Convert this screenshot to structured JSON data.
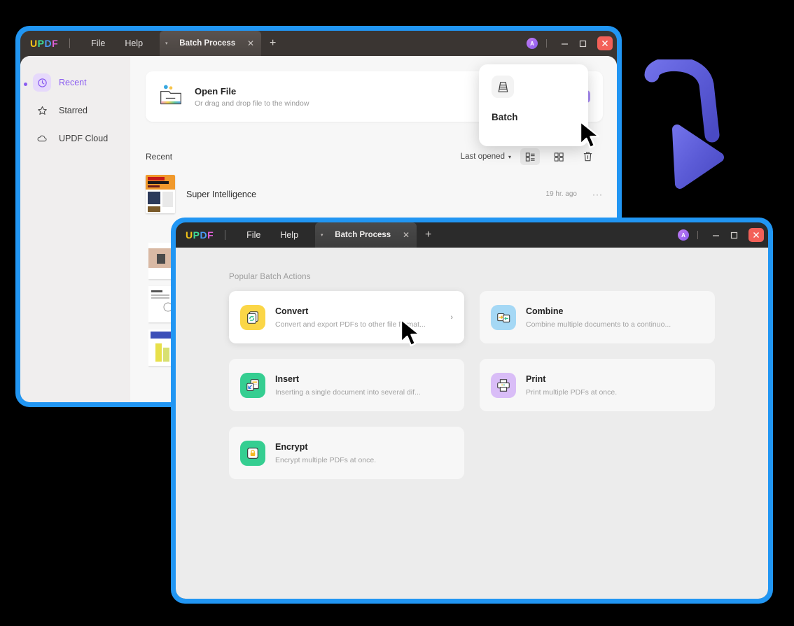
{
  "back_window": {
    "titlebar": {
      "logo": "UPDF",
      "menus": [
        "File",
        "Help"
      ],
      "tab": {
        "label": "Batch Process",
        "close": "✕",
        "caret": "▾"
      },
      "new_tab": "+",
      "avatar": "A",
      "minimize": "—",
      "maximize": "☐",
      "close": "✕"
    },
    "sidebar": {
      "items": [
        {
          "label": "Recent",
          "icon": "clock-icon",
          "active": true
        },
        {
          "label": "Starred",
          "icon": "star-icon",
          "active": false
        },
        {
          "label": "UPDF Cloud",
          "icon": "cloud-icon",
          "active": false
        }
      ]
    },
    "open_file": {
      "title": "Open File",
      "subtitle": "Or drag and drop file to the window",
      "go": "›"
    },
    "recent": {
      "heading": "Recent",
      "sort_label": "Last opened",
      "sort_caret": "▾",
      "view_list_icon": "list-view-icon",
      "view_grid_icon": "grid-view-icon",
      "delete_icon": "trash-icon",
      "items": [
        {
          "name": "Super Intelligence",
          "time": "19 hr. ago",
          "more": "···"
        }
      ]
    },
    "batch_popup": {
      "label": "Batch",
      "icon": "batch-stack-icon"
    }
  },
  "front_window": {
    "titlebar": {
      "logo": "UPDF",
      "menus": [
        "File",
        "Help"
      ],
      "tab": {
        "label": "Batch Process",
        "close": "✕",
        "caret": "▾"
      },
      "new_tab": "+",
      "avatar": "A",
      "minimize": "—",
      "maximize": "☐",
      "close": "✕"
    },
    "section_title": "Popular Batch Actions",
    "cards": [
      {
        "title": "Convert",
        "subtitle": "Convert and export PDFs to other file format...",
        "icon": "convert-icon",
        "icon_bg": "#fbd647",
        "selected": true,
        "arrow": "›"
      },
      {
        "title": "Combine",
        "subtitle": "Combine multiple documents to a continuo...",
        "icon": "combine-icon",
        "icon_bg": "#a5d8f5",
        "selected": false,
        "arrow": ""
      },
      {
        "title": "Insert",
        "subtitle": "Inserting a single document into several dif...",
        "icon": "insert-icon",
        "icon_bg": "#35ce91",
        "selected": false,
        "arrow": ""
      },
      {
        "title": "Print",
        "subtitle": "Print multiple PDFs at once.",
        "icon": "print-icon",
        "icon_bg": "#d9bdf7",
        "selected": false,
        "arrow": ""
      },
      {
        "title": "Encrypt",
        "subtitle": "Encrypt multiple PDFs at once.",
        "icon": "encrypt-icon",
        "icon_bg": "#35ce91",
        "selected": false,
        "arrow": ""
      }
    ]
  },
  "colors": {
    "window_border": "#2196f3",
    "titlebar_back": "#3a3532",
    "titlebar_front": "#2b2b2b",
    "accent_purple": "#8a5cf0",
    "close_red": "#f36058",
    "decoration_arrow": "#5b5bd6",
    "background": "#000000"
  },
  "decoration": {
    "arrow": "curved-3d-arrow"
  }
}
